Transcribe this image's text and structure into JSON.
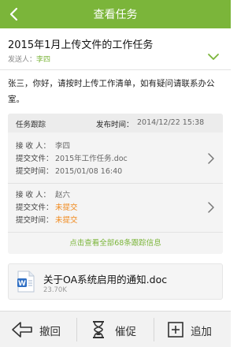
{
  "header": {
    "title": "查看任务",
    "back_icon": "back-chevron-icon"
  },
  "task": {
    "title": "2015年1月上传文件的工作任务",
    "sender_label": "发送人：",
    "sender_name": "李四",
    "message": "张三，你好，请按时上传工作清单，如有疑问请联系办公室。"
  },
  "tracking": {
    "header_label": "任务跟踪",
    "publish_time_label": "发布时间：",
    "publish_time": "2014/12/22 15:38",
    "records": [
      {
        "receiver_label": "接 收 人：",
        "receiver": "李四",
        "file_label": "提交文件：",
        "file": "2015年工作任务.doc",
        "time_label": "提交时间：",
        "time": "2015/01/08 16:40"
      },
      {
        "receiver_label": "接 收 人：",
        "receiver": "赵六",
        "file_label": "提交文件：",
        "file": "未提交",
        "time_label": "提交时间：",
        "time": "未提交"
      }
    ],
    "more_link": "点击查看全部68条跟踪信息"
  },
  "attachment": {
    "name": "关于OA系统启用的通知.doc",
    "size": "23.70K",
    "icon": "word-doc-icon"
  },
  "bottom_bar": {
    "revoke_label": "撤回",
    "remind_label": "催促",
    "extra_label": "追加"
  },
  "colors": {
    "brand_green": "#7bb53a",
    "pending_orange": "#f08a1e"
  }
}
